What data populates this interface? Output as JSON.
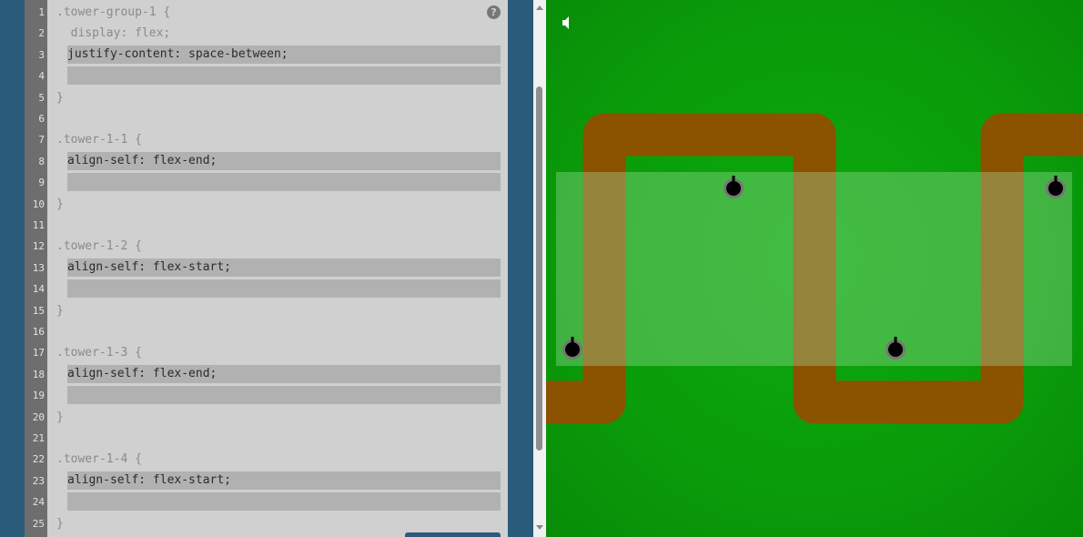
{
  "editor": {
    "lines": [
      {
        "n": "1",
        "text": ".tower-group-1 {",
        "type": "code"
      },
      {
        "n": "2",
        "text": "  display: flex;",
        "type": "code"
      },
      {
        "n": "3",
        "text": "justify-content: space-between;",
        "type": "input"
      },
      {
        "n": "4",
        "text": "",
        "type": "input"
      },
      {
        "n": "5",
        "text": "}",
        "type": "code"
      },
      {
        "n": "6",
        "text": "",
        "type": "code"
      },
      {
        "n": "7",
        "text": ".tower-1-1 {",
        "type": "code"
      },
      {
        "n": "8",
        "text": "align-self: flex-end;",
        "type": "input"
      },
      {
        "n": "9",
        "text": "",
        "type": "input"
      },
      {
        "n": "10",
        "text": "}",
        "type": "code"
      },
      {
        "n": "11",
        "text": "",
        "type": "code"
      },
      {
        "n": "12",
        "text": ".tower-1-2 {",
        "type": "code"
      },
      {
        "n": "13",
        "text": "align-self: flex-start;",
        "type": "input"
      },
      {
        "n": "14",
        "text": "",
        "type": "input"
      },
      {
        "n": "15",
        "text": "}",
        "type": "code"
      },
      {
        "n": "16",
        "text": "",
        "type": "code"
      },
      {
        "n": "17",
        "text": ".tower-1-3 {",
        "type": "code"
      },
      {
        "n": "18",
        "text": "align-self: flex-end;",
        "type": "input"
      },
      {
        "n": "19",
        "text": "",
        "type": "input"
      },
      {
        "n": "20",
        "text": "}",
        "type": "code"
      },
      {
        "n": "21",
        "text": "",
        "type": "code"
      },
      {
        "n": "22",
        "text": ".tower-1-4 {",
        "type": "code"
      },
      {
        "n": "23",
        "text": "align-self: flex-start;",
        "type": "input"
      },
      {
        "n": "24",
        "text": "",
        "type": "input"
      },
      {
        "n": "25",
        "text": "}",
        "type": "code"
      }
    ],
    "help_icon": "question-mark-icon",
    "help_label": "?"
  },
  "game": {
    "sound_icon": "speaker-icon",
    "tower_count": 4,
    "colors": {
      "grass": "#0aa00a",
      "path": "#8b5200",
      "tower_zone": "rgba(170,225,170,0.35)",
      "tower_body": "#000000",
      "tower_ring": "#777777"
    }
  }
}
